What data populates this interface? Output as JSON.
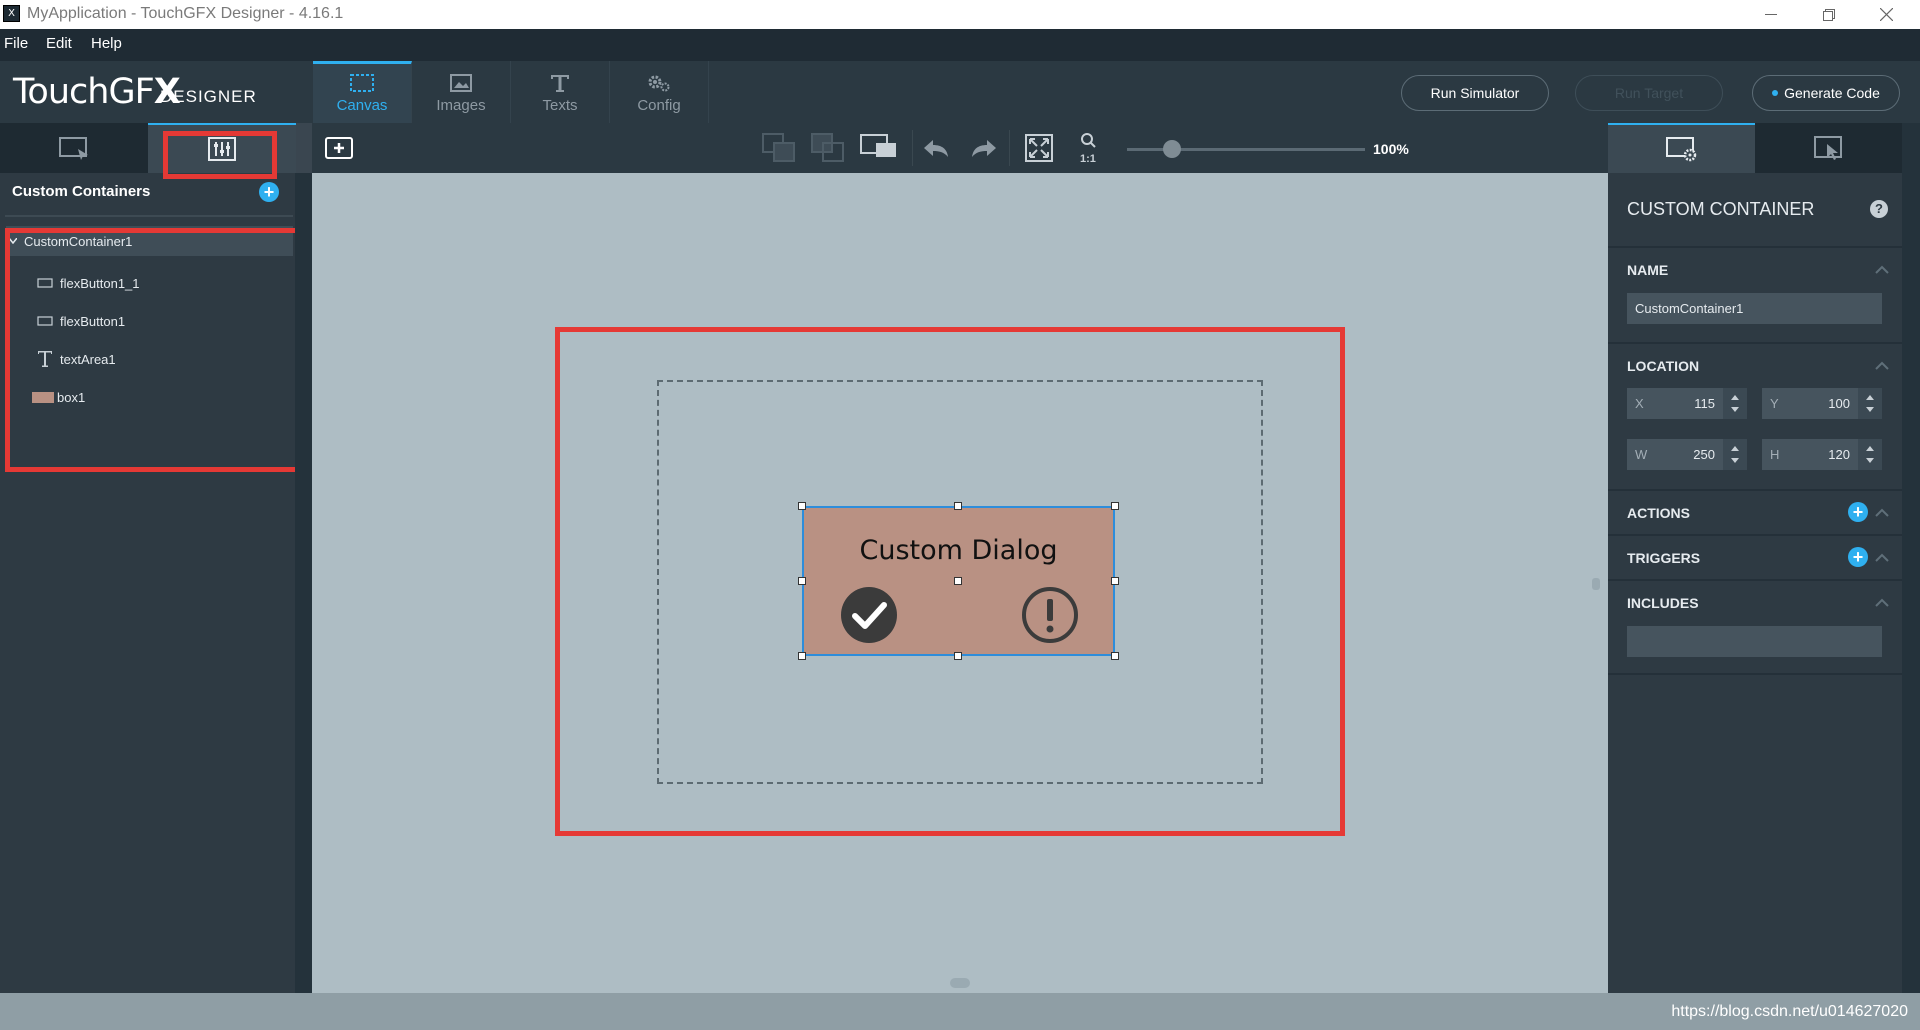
{
  "window": {
    "title": "MyApplication - TouchGFX Designer - 4.16.1"
  },
  "menu": {
    "items": [
      {
        "label": "File"
      },
      {
        "label": "Edit"
      },
      {
        "label": "Help"
      }
    ]
  },
  "logo": {
    "brand_light": "TouchGF",
    "brand_bold": "X",
    "sub": "DESIGNER"
  },
  "nav_tabs": [
    {
      "label": "Canvas",
      "icon": "canvas-selection-icon",
      "active": true
    },
    {
      "label": "Images",
      "icon": "image-icon",
      "active": false
    },
    {
      "label": "Texts",
      "icon": "text-t-icon",
      "active": false
    },
    {
      "label": "Config",
      "icon": "gears-icon",
      "active": false
    }
  ],
  "actions": {
    "run_simulator": "Run Simulator",
    "run_target": "Run Target",
    "generate_code": "Generate Code"
  },
  "left_panel": {
    "tabs": [
      {
        "icon": "screen-select-icon",
        "active": false
      },
      {
        "icon": "custom-container-sliders-icon",
        "active": true
      }
    ],
    "header": "Custom Containers",
    "tree": [
      {
        "label": "CustomContainer1",
        "icon": "chevron-down-icon",
        "selected": true
      },
      {
        "label": "flexButton1_1",
        "icon": "button-outline-icon",
        "selected": false
      },
      {
        "label": "flexButton1",
        "icon": "button-outline-icon",
        "selected": false
      },
      {
        "label": "textArea1",
        "icon": "text-t-icon",
        "selected": false
      },
      {
        "label": "box1",
        "icon": "box-swatch-icon",
        "color": "#b99183",
        "selected": false
      }
    ]
  },
  "canvas_toolbar": {
    "zoom_label": "100%",
    "zoom_percent": 100
  },
  "canvas": {
    "background": "#aebdc4",
    "dialog": {
      "title": "Custom Dialog",
      "background": "#b99183",
      "selection_color": "#2d8ddb"
    },
    "annotation_color": "#e53935"
  },
  "properties": {
    "title": "CUSTOM CONTAINER",
    "name": {
      "label": "NAME",
      "value": "CustomContainer1"
    },
    "location": {
      "label": "LOCATION",
      "x": {
        "key": "X",
        "value": "115"
      },
      "y": {
        "key": "Y",
        "value": "100"
      },
      "w": {
        "key": "W",
        "value": "250"
      },
      "h": {
        "key": "H",
        "value": "120"
      }
    },
    "actions_label": "ACTIONS",
    "triggers_label": "TRIGGERS",
    "includes_label": "INCLUDES"
  },
  "watermark": "https://blog.csdn.net/u014627020"
}
